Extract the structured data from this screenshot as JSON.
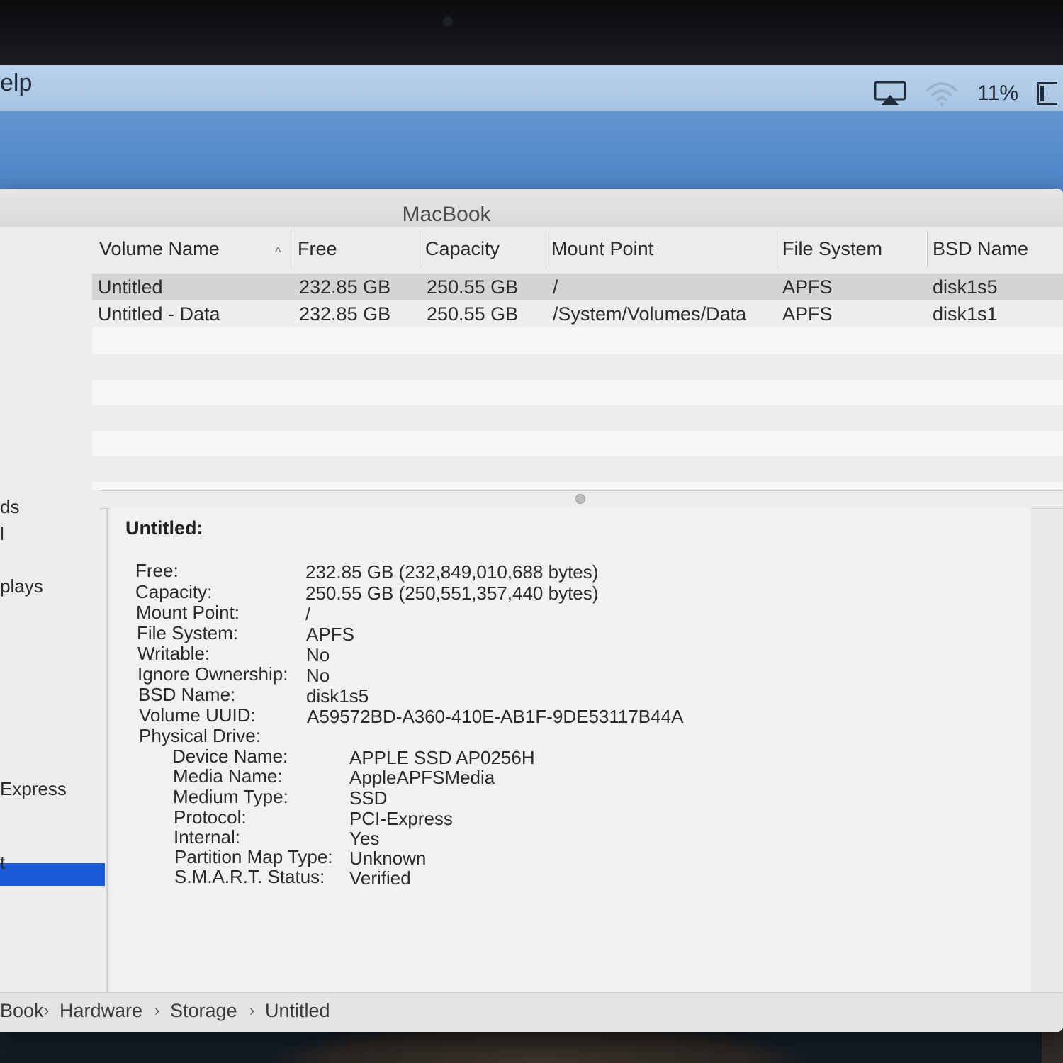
{
  "menubar": {
    "help_fragment": "elp",
    "battery_percent": "11%"
  },
  "window": {
    "title": "MacBook"
  },
  "sidebar": {
    "items": [
      "ds",
      "l",
      "plays",
      "Express",
      "t"
    ],
    "selected_index": 4
  },
  "table": {
    "headers": [
      "Volume Name",
      "Free",
      "Capacity",
      "Mount Point",
      "File System",
      "BSD Name"
    ],
    "sort_indicator": "^",
    "rows": [
      [
        "Untitled",
        "232.85 GB",
        "250.55 GB",
        "/",
        "APFS",
        "disk1s5"
      ],
      [
        "Untitled - Data",
        "232.85 GB",
        "250.55 GB",
        "/System/Volumes/Data",
        "APFS",
        "disk1s1"
      ]
    ]
  },
  "detail": {
    "title": "Untitled:",
    "fields": [
      {
        "label": "Free:",
        "value": "232.85 GB (232,849,010,688 bytes)"
      },
      {
        "label": "Capacity:",
        "value": "250.55 GB (250,551,357,440 bytes)"
      },
      {
        "label": "Mount Point:",
        "value": "/"
      },
      {
        "label": "File System:",
        "value": "APFS"
      },
      {
        "label": "Writable:",
        "value": "No"
      },
      {
        "label": "Ignore Ownership:",
        "value": "No"
      },
      {
        "label": "BSD Name:",
        "value": "disk1s5"
      },
      {
        "label": "Volume UUID:",
        "value": "A59572BD-A360-410E-AB1F-9DE53117B44A"
      },
      {
        "label": "Physical Drive:",
        "value": ""
      }
    ],
    "physical_drive": [
      {
        "label": "Device Name:",
        "value": "APPLE SSD AP0256H"
      },
      {
        "label": "Media Name:",
        "value": "AppleAPFSMedia"
      },
      {
        "label": "Medium Type:",
        "value": "SSD"
      },
      {
        "label": "Protocol:",
        "value": "PCI-Express"
      },
      {
        "label": "Internal:",
        "value": "Yes"
      },
      {
        "label": "Partition Map Type:",
        "value": "Unknown"
      },
      {
        "label": "S.M.A.R.T. Status:",
        "value": "Verified"
      }
    ]
  },
  "breadcrumb": {
    "items": [
      "Book",
      "Hardware",
      "Storage",
      "Untitled"
    ],
    "separator": "›"
  },
  "icons": {
    "airplay": "airplay-icon",
    "wifi": "wifi-icon",
    "battery": "battery-icon"
  },
  "colors": {
    "selection_accent": "#1a5bd6"
  }
}
